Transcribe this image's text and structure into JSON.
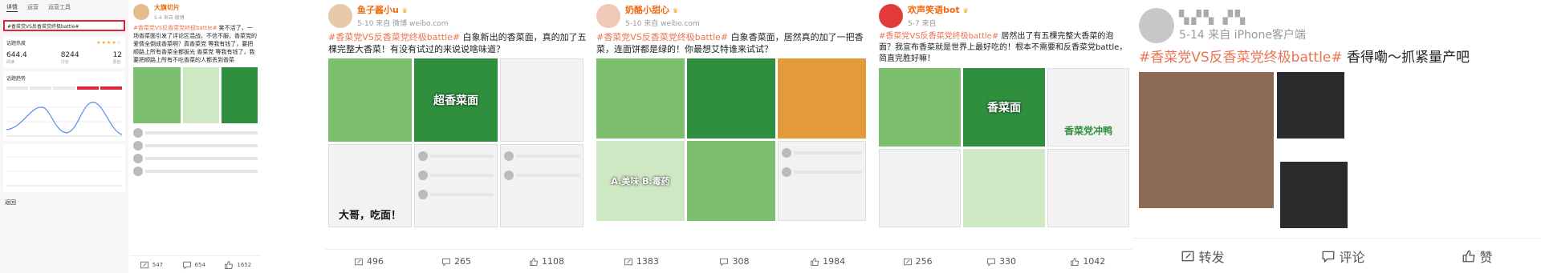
{
  "analytics": {
    "tabs": [
      "详情",
      "运营",
      "运营工具"
    ],
    "search_query": "#香菜党VS反香菜党终极battle#",
    "card_hot_title": "话题热度",
    "metrics": [
      {
        "value": "644.4",
        "label": "阅读"
      },
      {
        "value": "8244",
        "label": "讨论"
      },
      {
        "value": "12",
        "label": "原创"
      }
    ],
    "trend_title": "话题趋势",
    "back_label": "返回",
    "rating": 4
  },
  "posts": [
    {
      "author": "大旗切片",
      "meta": "5-4  来自 微博",
      "text_tag": "#香菜党VS反香菜党终极battle#",
      "text": " 笑不活了，一场香菜面引发了评论区混战，不信不服，香菜党的爱情全倒成香菜啊？真香菜党 等我有钱了，要把顺路上所有香菜全都拔光 香菜党 等我有钱了，我要把顺路上所有不吃香菜的人都丢到香菜",
      "stats": {
        "repost": "547",
        "comment": "654",
        "like": "1652"
      }
    },
    {
      "author": "鱼子酱小u",
      "meta": "5-10  来自 微博 weibo.com",
      "text_tag": "#香菜党VS反香菜党终极battle#",
      "text": " 白象新出的香菜面，真的加了五棵完整大香菜！有没有试过的来说说啥味道？",
      "img_label": "超香菜面",
      "meme_text": "大哥，吃面！",
      "stats": {
        "repost": "496",
        "comment": "265",
        "like": "1108"
      }
    },
    {
      "author": "奶酪小甜心",
      "meta": "5-10  来自 weibo.com",
      "text_tag": "#香菜党VS反香菜党终极battle#",
      "text": " 白象香菜面，居然真的加了一把香菜，连面饼都是绿的！你最想艾特谁来试试？",
      "img_label": "A.美味 B.毒药",
      "stats": {
        "repost": "1383",
        "comment": "308",
        "like": "1984"
      }
    },
    {
      "author": "欢声笑语bot",
      "meta": "5-7  来自",
      "text_tag": "#香菜党VS反香菜党终极battle#",
      "text": " 居然出了有五棵完整大香菜的泡面？我宣布香菜就是世界上最好吃的！根本不需要和反香菜党battle，简直完胜好嘛！",
      "img_label": "香菜党冲鸭",
      "img_label2": "香菜面",
      "stats": {
        "repost": "256",
        "comment": "330",
        "like": "1042"
      }
    },
    {
      "author": "",
      "meta": "5-14  来自 iPhone客户端",
      "text_tag": "#香菜党VS反香菜党终极battle#",
      "text": " 香得嘞～抓紧量产吧",
      "stats": {
        "repost": "转发",
        "comment": "评论",
        "like": "赞"
      }
    }
  ],
  "colors": {
    "accent": "#eb7350",
    "highlight": "#e0243a",
    "name": "#f06a0f"
  }
}
